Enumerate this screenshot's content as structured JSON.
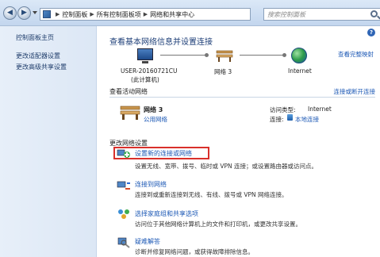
{
  "addressbar": {
    "breadcrumbs": [
      "控制面板",
      "所有控制面板项",
      "网络和共享中心"
    ],
    "search_placeholder": "搜索控制面板"
  },
  "sidebar": {
    "items": [
      {
        "label": "控制面板主页"
      },
      {
        "label": "更改适配器设置"
      },
      {
        "label": "更改高级共享设置"
      }
    ]
  },
  "main": {
    "heading": "查看基本网络信息并设置连接",
    "full_map_link": "查看完整映射",
    "map": {
      "computer_name": "USER-20160721CU",
      "computer_sub": "(此计算机)",
      "network_name": "网络 3",
      "internet_label": "Internet"
    },
    "active": {
      "title": "查看活动网络",
      "connect_link": "连接或断开连接",
      "network_name": "网络 3",
      "network_type": "公用网络",
      "access_type_label": "访问类型:",
      "access_type_value": "Internet",
      "connection_label": "连接:",
      "connection_value": "本地连接"
    },
    "settings": {
      "title": "更改网络设置",
      "tasks": [
        {
          "title": "设置新的连接或网络",
          "desc": "设置无线、宽带、拨号、临时或 VPN 连接；或设置路由器或访问点。"
        },
        {
          "title": "连接到网络",
          "desc": "连接到或重新连接到无线、有线、拨号或 VPN 网络连接。"
        },
        {
          "title": "选择家庭组和共享选项",
          "desc": "访问位于其他网络计算机上的文件和打印机，或更改共享设置。"
        },
        {
          "title": "疑难解答",
          "desc": "诊断并修复网络问题，或获得故障排除信息。"
        }
      ]
    }
  },
  "colors": {
    "link": "#1c58b5",
    "highlight_border": "#d9302b",
    "sidebar_bg": "#dce7f5"
  }
}
